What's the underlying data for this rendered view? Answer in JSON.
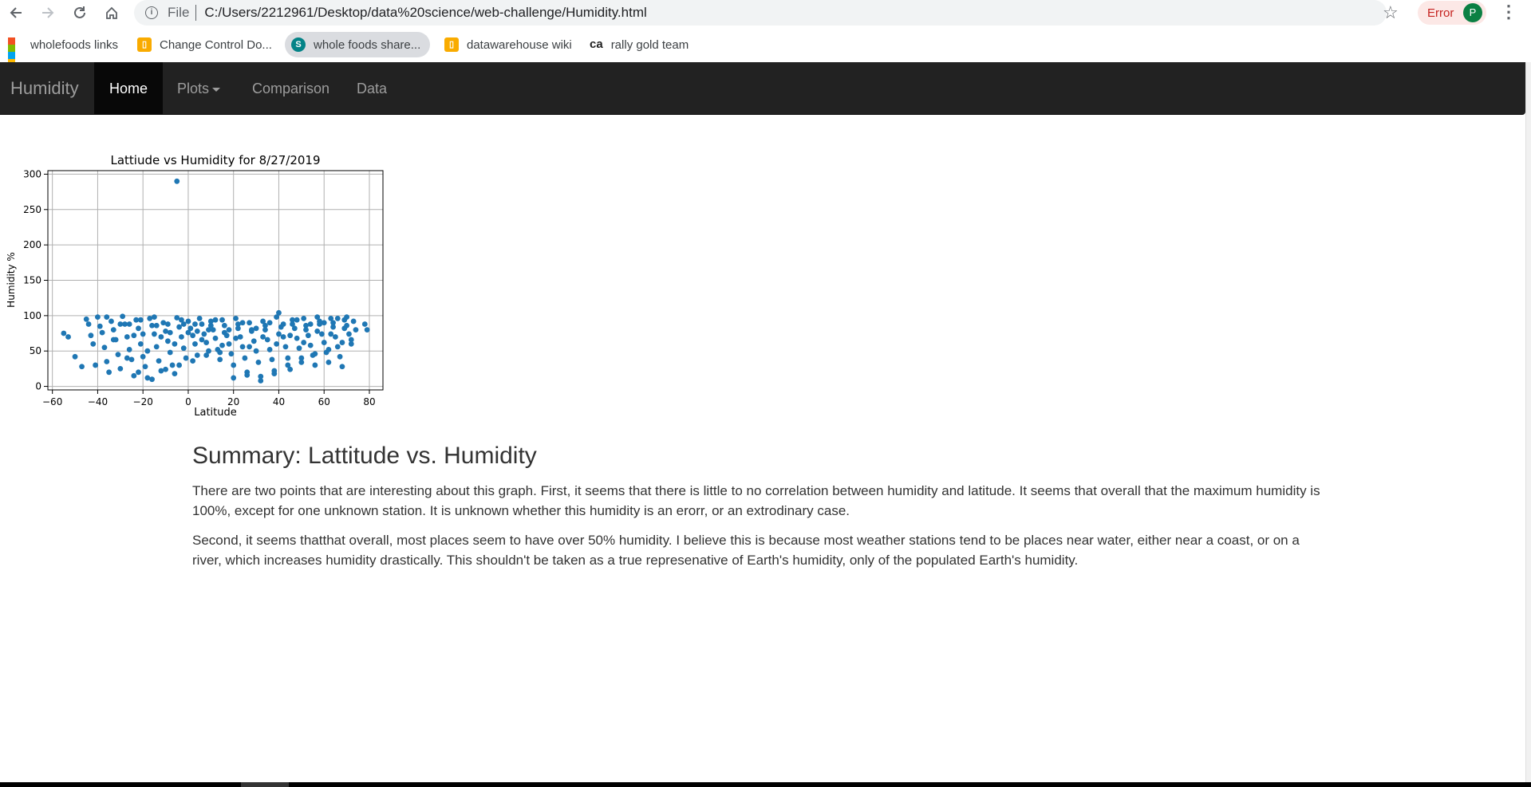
{
  "browser": {
    "back_icon": "back-arrow-icon",
    "url_prefix": "File",
    "url": "C:/Users/2212961/Desktop/data%20science/web-challenge/Humidity.html",
    "error_label": "Error",
    "profile_initial": "P",
    "bookmarks": [
      {
        "label": "wholefoods links",
        "icon": "microsoft-icon"
      },
      {
        "label": "Change Control Do...",
        "icon": "folder-icon"
      },
      {
        "label": "whole foods share...",
        "icon": "sharepoint-icon"
      },
      {
        "label": "datawarehouse wiki",
        "icon": "folder-icon"
      },
      {
        "label": "rally gold team",
        "icon": "ca-icon"
      }
    ]
  },
  "navbar": {
    "brand": "Humidity",
    "items": [
      {
        "label": "Home"
      },
      {
        "label": "Plots"
      },
      {
        "label": "Comparison"
      },
      {
        "label": "Data"
      }
    ]
  },
  "chart_data": {
    "type": "scatter",
    "title": "Lattiude vs Humidity for 8/27/2019",
    "xlabel": "Latitude",
    "ylabel": "Humidity %",
    "xlim": [
      -62,
      86
    ],
    "ylim": [
      -5,
      305
    ],
    "xticks": [
      "−60",
      "−40",
      "−20",
      "0",
      "20",
      "40",
      "60",
      "80"
    ],
    "yticks": [
      "0",
      "50",
      "100",
      "150",
      "200",
      "250",
      "300"
    ],
    "grid": true,
    "color": "#1f77b4",
    "points": [
      [
        -5,
        290
      ],
      [
        -55,
        75
      ],
      [
        -53,
        70
      ],
      [
        -50,
        42
      ],
      [
        -47,
        28
      ],
      [
        -45,
        95
      ],
      [
        -44,
        88
      ],
      [
        -43,
        72
      ],
      [
        -42,
        60
      ],
      [
        -41,
        30
      ],
      [
        -40,
        98
      ],
      [
        -39,
        85
      ],
      [
        -38,
        76
      ],
      [
        -37,
        55
      ],
      [
        -36,
        35
      ],
      [
        -35,
        20
      ],
      [
        -34,
        92
      ],
      [
        -33,
        80
      ],
      [
        -32,
        66
      ],
      [
        -31,
        45
      ],
      [
        -30,
        25
      ],
      [
        -29,
        99
      ],
      [
        -28,
        88
      ],
      [
        -27,
        70
      ],
      [
        -26,
        52
      ],
      [
        -25,
        38
      ],
      [
        -24,
        15
      ],
      [
        -23,
        94
      ],
      [
        -22,
        82
      ],
      [
        -21,
        60
      ],
      [
        -20,
        42
      ],
      [
        -19,
        28
      ],
      [
        -18,
        12
      ],
      [
        -17,
        96
      ],
      [
        -16,
        86
      ],
      [
        -15,
        74
      ],
      [
        -14,
        56
      ],
      [
        -13,
        36
      ],
      [
        -12,
        22
      ],
      [
        -11,
        90
      ],
      [
        -10,
        78
      ],
      [
        -9,
        64
      ],
      [
        -8,
        48
      ],
      [
        -7,
        30
      ],
      [
        -6,
        18
      ],
      [
        -5,
        97
      ],
      [
        -4,
        84
      ],
      [
        -3,
        70
      ],
      [
        -2,
        54
      ],
      [
        -1,
        40
      ],
      [
        0,
        92
      ],
      [
        1,
        82
      ],
      [
        2,
        72
      ],
      [
        3,
        60
      ],
      [
        4,
        44
      ],
      [
        5,
        96
      ],
      [
        6,
        88
      ],
      [
        7,
        74
      ],
      [
        8,
        62
      ],
      [
        9,
        50
      ],
      [
        10,
        92
      ],
      [
        11,
        80
      ],
      [
        12,
        68
      ],
      [
        13,
        52
      ],
      [
        14,
        38
      ],
      [
        15,
        94
      ],
      [
        16,
        86
      ],
      [
        17,
        72
      ],
      [
        18,
        60
      ],
      [
        19,
        46
      ],
      [
        20,
        30
      ],
      [
        21,
        96
      ],
      [
        22,
        82
      ],
      [
        23,
        70
      ],
      [
        24,
        56
      ],
      [
        25,
        40
      ],
      [
        26,
        20
      ],
      [
        27,
        90
      ],
      [
        28,
        78
      ],
      [
        29,
        64
      ],
      [
        30,
        50
      ],
      [
        31,
        34
      ],
      [
        32,
        14
      ],
      [
        33,
        92
      ],
      [
        34,
        80
      ],
      [
        35,
        66
      ],
      [
        36,
        52
      ],
      [
        37,
        38
      ],
      [
        38,
        22
      ],
      [
        39,
        98
      ],
      [
        40,
        104
      ],
      [
        41,
        84
      ],
      [
        42,
        70
      ],
      [
        43,
        56
      ],
      [
        44,
        40
      ],
      [
        45,
        24
      ],
      [
        46,
        94
      ],
      [
        47,
        82
      ],
      [
        48,
        68
      ],
      [
        49,
        54
      ],
      [
        50,
        40
      ],
      [
        51,
        96
      ],
      [
        52,
        86
      ],
      [
        53,
        72
      ],
      [
        54,
        58
      ],
      [
        55,
        44
      ],
      [
        56,
        30
      ],
      [
        57,
        98
      ],
      [
        58,
        88
      ],
      [
        59,
        74
      ],
      [
        60,
        62
      ],
      [
        61,
        48
      ],
      [
        62,
        34
      ],
      [
        63,
        96
      ],
      [
        64,
        84
      ],
      [
        65,
        70
      ],
      [
        66,
        56
      ],
      [
        67,
        42
      ],
      [
        68,
        28
      ],
      [
        69,
        94
      ],
      [
        70,
        86
      ],
      [
        71,
        74
      ],
      [
        72,
        60
      ],
      [
        73,
        92
      ],
      [
        74,
        80
      ],
      [
        78,
        88
      ],
      [
        79,
        80
      ],
      [
        -36,
        98
      ],
      [
        -33,
        66
      ],
      [
        -30,
        88
      ],
      [
        -27,
        40
      ],
      [
        -24,
        72
      ],
      [
        -21,
        94
      ],
      [
        -18,
        50
      ],
      [
        -15,
        98
      ],
      [
        -12,
        70
      ],
      [
        -9,
        88
      ],
      [
        -6,
        60
      ],
      [
        -3,
        94
      ],
      [
        0,
        76
      ],
      [
        3,
        88
      ],
      [
        6,
        66
      ],
      [
        9,
        80
      ],
      [
        12,
        94
      ],
      [
        15,
        58
      ],
      [
        18,
        80
      ],
      [
        21,
        68
      ],
      [
        24,
        90
      ],
      [
        27,
        56
      ],
      [
        30,
        82
      ],
      [
        33,
        70
      ],
      [
        36,
        90
      ],
      [
        39,
        60
      ],
      [
        42,
        88
      ],
      [
        45,
        72
      ],
      [
        48,
        94
      ],
      [
        51,
        62
      ],
      [
        54,
        88
      ],
      [
        57,
        78
      ],
      [
        60,
        90
      ],
      [
        63,
        74
      ],
      [
        66,
        96
      ],
      [
        69,
        82
      ],
      [
        72,
        66
      ],
      [
        -26,
        88
      ],
      [
        -20,
        74
      ],
      [
        -14,
        86
      ],
      [
        -8,
        76
      ],
      [
        -2,
        88
      ],
      [
        4,
        78
      ],
      [
        10,
        86
      ],
      [
        16,
        76
      ],
      [
        22,
        88
      ],
      [
        28,
        80
      ],
      [
        34,
        86
      ],
      [
        40,
        74
      ],
      [
        46,
        88
      ],
      [
        52,
        80
      ],
      [
        58,
        92
      ],
      [
        64,
        90
      ],
      [
        70,
        98
      ],
      [
        -22,
        20
      ],
      [
        -16,
        10
      ],
      [
        -10,
        24
      ],
      [
        -4,
        30
      ],
      [
        2,
        36
      ],
      [
        8,
        44
      ],
      [
        14,
        48
      ],
      [
        20,
        12
      ],
      [
        26,
        16
      ],
      [
        32,
        8
      ],
      [
        38,
        18
      ],
      [
        44,
        30
      ],
      [
        50,
        34
      ],
      [
        56,
        46
      ],
      [
        62,
        52
      ],
      [
        68,
        62
      ]
    ]
  },
  "summary": {
    "title": "Summary: Lattitude vs. Humidity",
    "paragraph1": "There are two points that are interesting about this graph. First, it seems that there is little to no correlation between humidity and latitude. It seems that overall that the maximum humidity is 100%, except for one unknown station. It is unknown whether this humidity is an erorr, or an extrodinary case.",
    "paragraph2": "Second, it seems thatthat overall, most places seem to have over 50% humidity. I believe this is because most weather stations tend to be places near water, either near a coast, or on a river, which increases humidity drastically. This shouldn't be taken as a true represenative of Earth's humidity, only of the populated Earth's humidity."
  }
}
